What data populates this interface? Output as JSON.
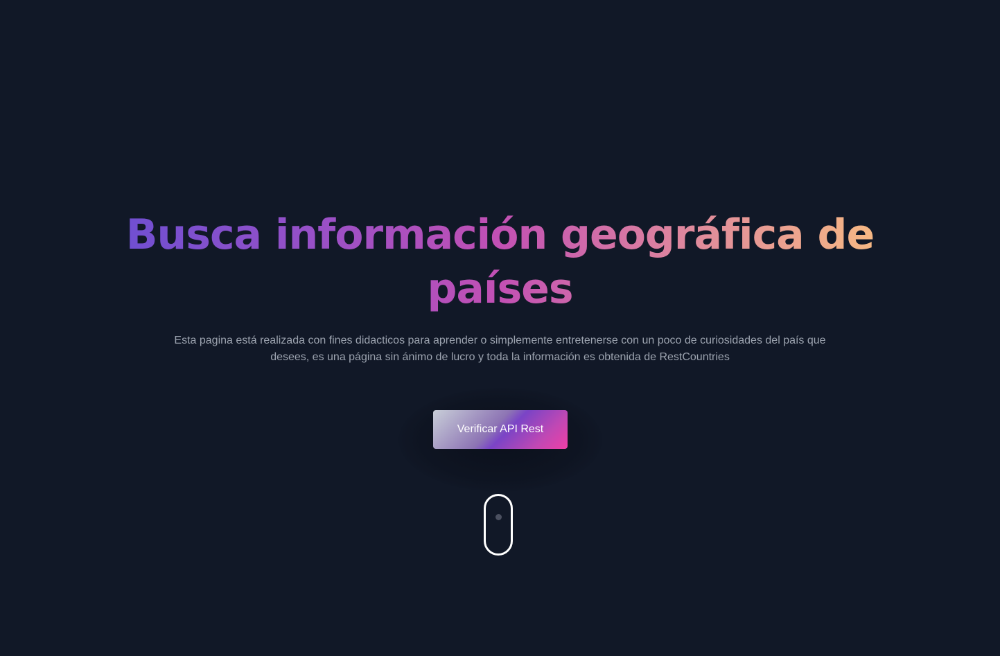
{
  "hero": {
    "title": "Busca información geográfica de países",
    "description": "Esta pagina está realizada con fines didacticos para aprender o simplemente entretenerse con un poco de curiosidades del país que desees, es una página sin ánimo de lucro y toda la información es obtenida de RestCountries",
    "cta_label": "Verificar API Rest",
    "scroll_indicator_icon": "mouse-scroll-icon"
  },
  "colors": {
    "background": "#111827",
    "title_gradient": [
      "#6d4fd2",
      "#c250b4",
      "#f8bc82"
    ],
    "button_gradient": [
      "#c8ced8",
      "#7a44c6",
      "#ee3fa6"
    ],
    "text_muted": "#9ca3af"
  }
}
